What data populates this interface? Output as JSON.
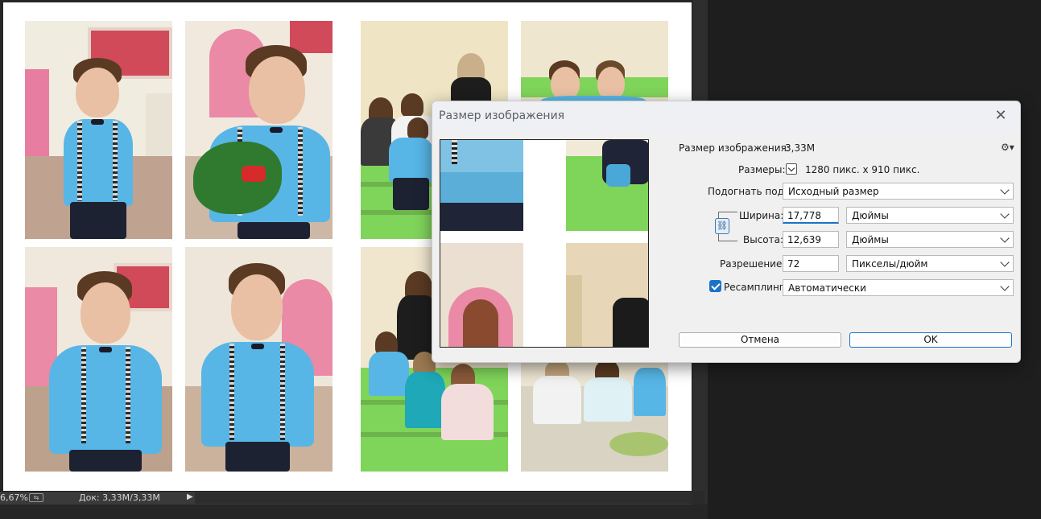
{
  "dialog": {
    "title": "Размер изображения",
    "image_size_label": "Размер изображения:",
    "image_size_value": "3,33M",
    "dimensions_label": "Размеры:",
    "dimensions_value": "1280 пикс. x 910 пикс.",
    "fit_to_label": "Подогнать под:",
    "fit_to_value": "Исходный размер",
    "width_label": "Ширина:",
    "width_value": "17,778",
    "width_unit": "Дюймы",
    "height_label": "Высота:",
    "height_value": "12,639",
    "height_unit": "Дюймы",
    "resolution_label": "Разрешение:",
    "resolution_value": "72",
    "resolution_unit": "Пикселы/дюйм",
    "resample_label": "Ресамплинг:",
    "resample_checked": true,
    "resample_value": "Автоматически",
    "cancel_label": "Отмена",
    "ok_label": "OK",
    "close_icon": "close-icon",
    "settings_icon": "gear-icon",
    "link_icon": "link-icon"
  },
  "statusbar": {
    "zoom": "6,67%",
    "doc_size": "Док: 3,33M/3,33M"
  },
  "colors": {
    "accent": "#1a73c8",
    "canvas_bg": "#ffffff",
    "workspace_bg": "#262626",
    "shirt": "#57b6e6"
  }
}
